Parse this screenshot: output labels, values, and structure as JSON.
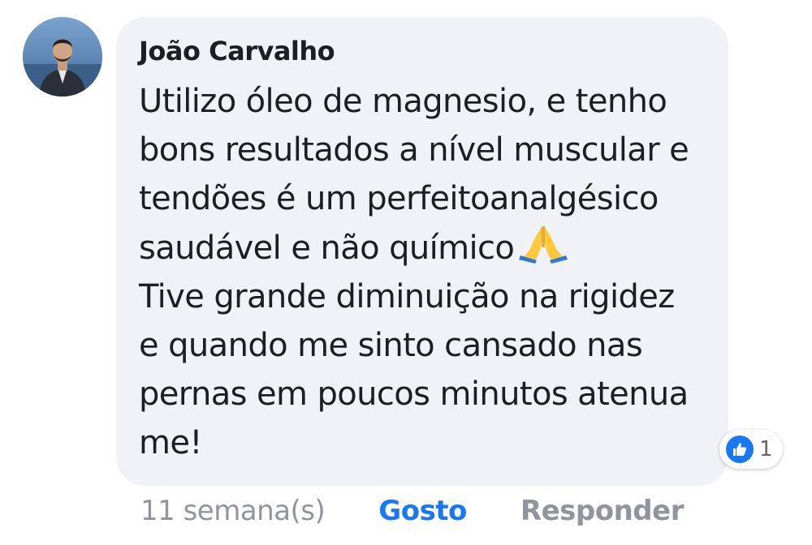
{
  "comment": {
    "author": "João Carvalho",
    "text": "Utilizo óleo de magnesio, e tenho\nbons resultados a nível muscular e\ntendões é um perfeitoanalgésico\nsaudável e não químico",
    "emoji": "folded-hands-emoji",
    "text_continued": "Tive grande diminuição na rigidez\ne quando me sinto cansado nas\npernas em poucos minutos atenua\nme!"
  },
  "reactions": {
    "icon": "thumbs-up-icon",
    "count": "1",
    "color": "#1877f2"
  },
  "actions": {
    "timestamp": "11 semana(s)",
    "like_label": "Gosto",
    "reply_label": "Responder"
  },
  "colors": {
    "bubble": "#f0f2f5",
    "text": "#1c1e21",
    "muted": "#90949c",
    "accent": "#1877f2"
  }
}
